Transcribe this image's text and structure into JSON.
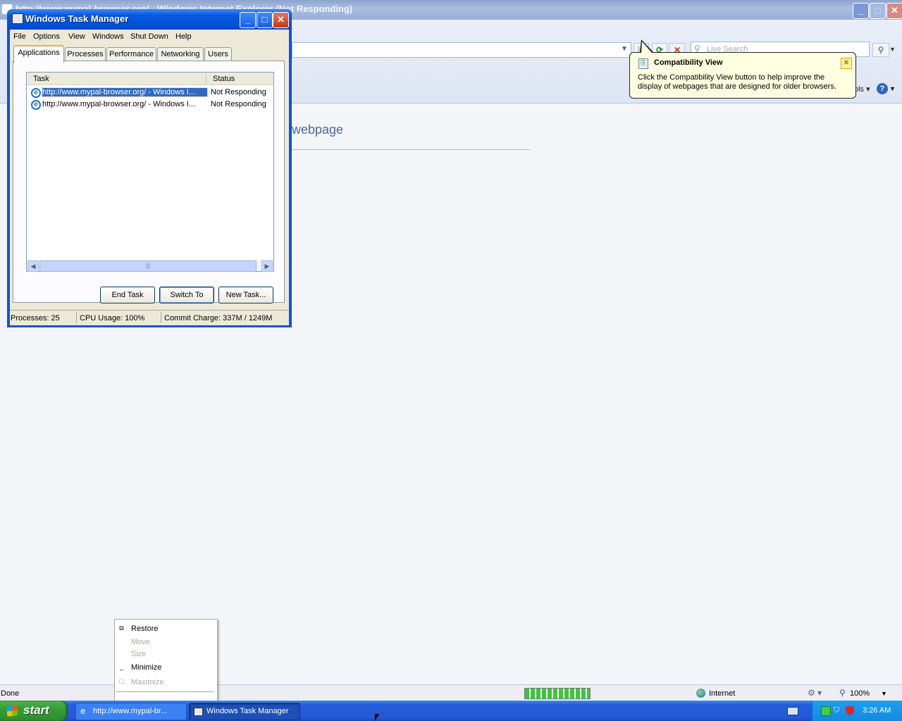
{
  "ie": {
    "title": "http://www.mypal-browser.org/ - Windows Internet Explorer (Not Responding)",
    "search_placeholder": "Live Search",
    "tools_fragment": "ols",
    "help_glyph": "?",
    "page_heading": "webpage",
    "balloon": {
      "title": "Compatibility View",
      "body": "Click the Compatibility View button to help improve the display of webpages that are designed for older browsers."
    },
    "status": {
      "text": "Done",
      "progress": 1.0,
      "zone": "Internet",
      "zoom": "100%"
    }
  },
  "task_manager": {
    "title": "Windows Task Manager",
    "menu": [
      "File",
      "Options",
      "View",
      "Windows",
      "Shut Down",
      "Help"
    ],
    "tabs": [
      "Applications",
      "Processes",
      "Performance",
      "Networking",
      "Users"
    ],
    "active_tab": "Applications",
    "columns": {
      "task": "Task",
      "status": "Status"
    },
    "rows": [
      {
        "task": "http://www.mypal-browser.org/ - Windows I...",
        "status": "Not Responding",
        "selected": true
      },
      {
        "task": "http://www.mypal-browser.org/ - Windows I...",
        "status": "Not Responding",
        "selected": false
      }
    ],
    "buttons": {
      "end_task": "End Task",
      "switch_to": "Switch To",
      "new_task": "New Task..."
    },
    "status": {
      "processes": "Processes: 25",
      "cpu": "CPU Usage: 100%",
      "commit": "Commit Charge: 337M / 1249M"
    }
  },
  "context_menu": {
    "items": [
      {
        "label": "Restore",
        "enabled": true
      },
      {
        "label": "Move",
        "enabled": false
      },
      {
        "label": "Size",
        "enabled": false
      },
      {
        "label": "Minimize",
        "enabled": true
      },
      {
        "label": "Maximize",
        "enabled": false
      }
    ]
  },
  "taskbar": {
    "start_label": "start",
    "buttons": [
      "http://www.mypal-br...",
      "Windows Task Manager"
    ],
    "clock": "3:26 AM"
  }
}
